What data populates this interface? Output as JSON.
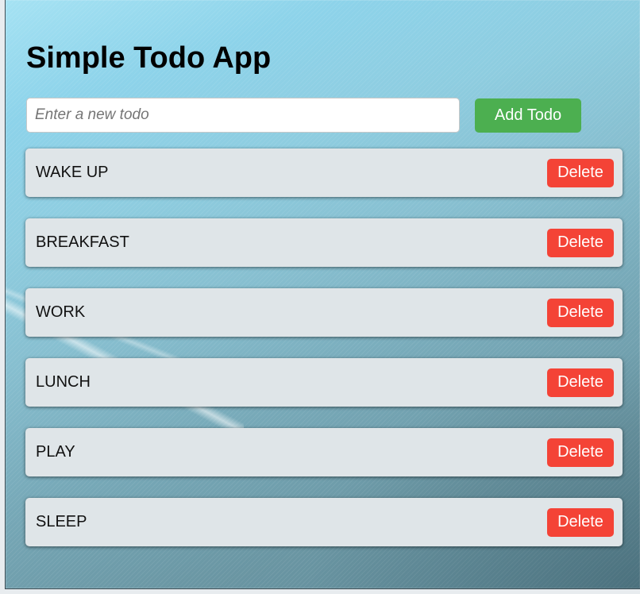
{
  "app": {
    "title": "Simple Todo App"
  },
  "form": {
    "input_value": "",
    "input_placeholder": "Enter a new todo",
    "add_label": "Add Todo"
  },
  "todos": [
    {
      "text": "WAKE UP",
      "delete_label": "Delete"
    },
    {
      "text": "BREAKFAST",
      "delete_label": "Delete"
    },
    {
      "text": "WORK",
      "delete_label": "Delete"
    },
    {
      "text": "LUNCH",
      "delete_label": "Delete"
    },
    {
      "text": "PLAY",
      "delete_label": "Delete"
    },
    {
      "text": "SLEEP",
      "delete_label": "Delete"
    }
  ],
  "colors": {
    "add_button": "#4caf50",
    "delete_button": "#f44336",
    "item_background": "#dfe5e8"
  }
}
